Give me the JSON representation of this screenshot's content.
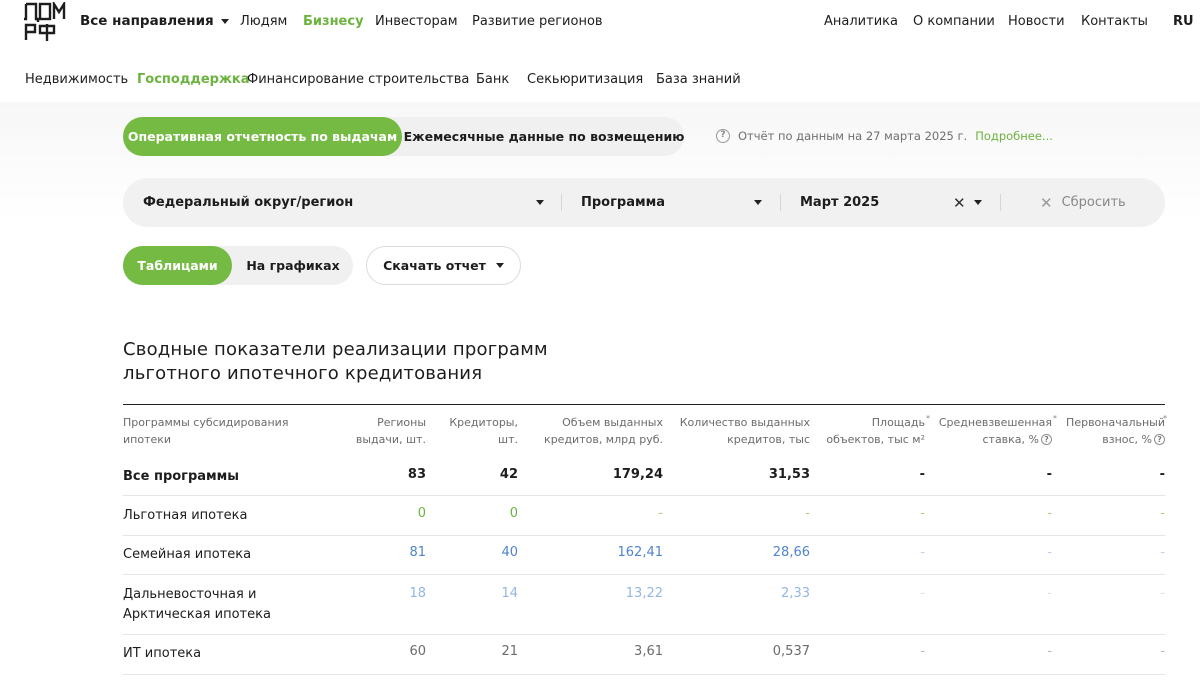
{
  "header": {
    "logo_text": "ДОМ РФ",
    "directions_label": "Все направления",
    "nav_left": [
      "Людям",
      "Бизнесу",
      "Инвесторам",
      "Развитие регионов"
    ],
    "nav_active": "Бизнесу",
    "nav_right": [
      "Аналитика",
      "О компании",
      "Новости",
      "Контакты"
    ],
    "lang": "RU"
  },
  "subnav": {
    "items": [
      "Недвижимость",
      "Господдержка",
      "Финансирование строительства",
      "Банк",
      "Секьюритизация",
      "База знаний"
    ],
    "active": "Господдержка"
  },
  "report_tabs": {
    "operational": "Оперативная отчетность по выдачам",
    "monthly": "Ежемесячные данные по возмещению",
    "info_text": "Отчёт по данным на 27 марта 2025 г.",
    "more_link": "Подробнее..."
  },
  "filters": {
    "region": "Федеральный округ/регион",
    "program": "Программа",
    "period": "Март 2025",
    "reset": "Сбросить"
  },
  "view": {
    "tables": "Таблицами",
    "charts": "На графиках",
    "download": "Скачать отчет"
  },
  "table": {
    "title_line1": "Сводные показатели реализации программ",
    "title_line2": "льготного ипотечного кредитования",
    "headers": {
      "program": [
        "Программы субсидирования",
        "ипотеки"
      ],
      "regions": [
        "Регионы",
        "выдачи, шт."
      ],
      "lenders": [
        "Кредиторы,",
        "шт."
      ],
      "volume": [
        "Объем выданных",
        "кредитов, млрд руб."
      ],
      "count": [
        "Количество выданных",
        "кредитов, тыс"
      ],
      "area": [
        "Площадь",
        "объектов, тыс м²"
      ],
      "rate": [
        "Средневзвешенная",
        "ставка, %"
      ],
      "downpayment": [
        "Первоначальный",
        "взнос, %"
      ],
      "asterisk": "*"
    },
    "rows": [
      {
        "name": [
          "Все программы"
        ],
        "regions": "83",
        "lenders": "42",
        "volume": "179,24",
        "count": "31,53",
        "area": "-",
        "rate": "-",
        "downpayment": "-"
      },
      {
        "name": [
          "Льготная ипотека"
        ],
        "regions": "0",
        "lenders": "0",
        "volume": "-",
        "count": "-",
        "area": "-",
        "rate": "-",
        "downpayment": "-"
      },
      {
        "name": [
          "Семейная ипотека"
        ],
        "regions": "81",
        "lenders": "40",
        "volume": "162,41",
        "count": "28,66",
        "area": "-",
        "rate": "-",
        "downpayment": "-"
      },
      {
        "name": [
          "Дальневосточная и",
          "Арктическая ипотека"
        ],
        "regions": "18",
        "lenders": "14",
        "volume": "13,22",
        "count": "2,33",
        "area": "-",
        "rate": "-",
        "downpayment": "-"
      },
      {
        "name": [
          "ИТ ипотека"
        ],
        "regions": "60",
        "lenders": "21",
        "volume": "3,61",
        "count": "0,537",
        "area": "-",
        "rate": "-",
        "downpayment": "-"
      }
    ]
  },
  "colors": {
    "accent_green": "#75bb43",
    "link_green": "#6cb33f",
    "value_blue": "#4f85cc"
  }
}
